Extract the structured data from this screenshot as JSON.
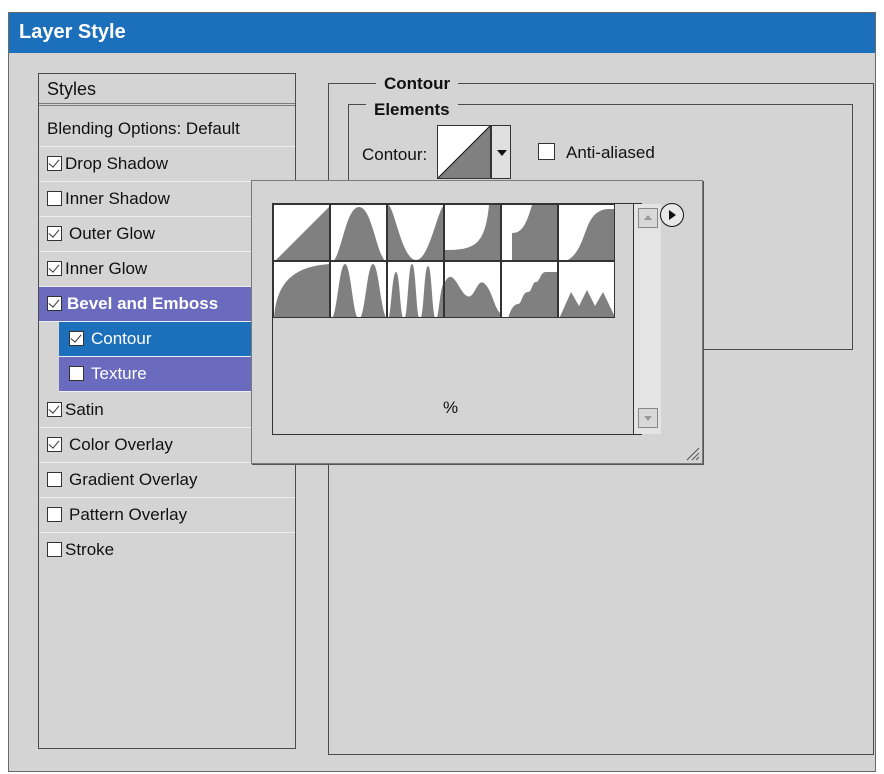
{
  "window": {
    "title": "Layer Style"
  },
  "styles_panel": {
    "header": "Styles",
    "items": [
      {
        "label": "Blending Options: Default",
        "checkbox": false,
        "checked": false
      },
      {
        "label": "Drop Shadow",
        "checkbox": true,
        "checked": true
      },
      {
        "label": "Inner Shadow",
        "checkbox": true,
        "checked": false
      },
      {
        "label": "Outer Glow",
        "checkbox": true,
        "checked": true
      },
      {
        "label": "Inner Glow",
        "checkbox": true,
        "checked": true
      },
      {
        "label": "Bevel and Emboss",
        "checkbox": true,
        "checked": true
      },
      {
        "label": "Contour",
        "checkbox": true,
        "checked": true
      },
      {
        "label": "Texture",
        "checkbox": true,
        "checked": false
      },
      {
        "label": "Satin",
        "checkbox": true,
        "checked": true
      },
      {
        "label": "Color Overlay",
        "checkbox": true,
        "checked": true
      },
      {
        "label": "Gradient Overlay",
        "checkbox": true,
        "checked": false
      },
      {
        "label": "Pattern Overlay",
        "checkbox": true,
        "checked": false
      },
      {
        "label": "Stroke",
        "checkbox": true,
        "checked": false
      }
    ]
  },
  "contour_section": {
    "group_label": "Contour",
    "elements_label": "Elements",
    "contour_label": "Contour:",
    "anti_aliased_label": "Anti-aliased",
    "anti_aliased_checked": false
  },
  "contour_picker": {
    "presets": [
      "linear",
      "cone",
      "cone-inverted",
      "cove-deep",
      "cove-shallow",
      "gaussian",
      "half-round",
      "ring",
      "ring-double",
      "rolling-slope",
      "rounded-steps",
      "sawtooth"
    ],
    "percent_label": "%",
    "menu_icon": "play-circle-icon"
  },
  "colors": {
    "titlebar": "#1b6fbb",
    "selected": "#1b6fbb",
    "highlight": "#6a6abf",
    "dialog_bg": "#d4d4d4",
    "curve_fill": "#808080"
  }
}
